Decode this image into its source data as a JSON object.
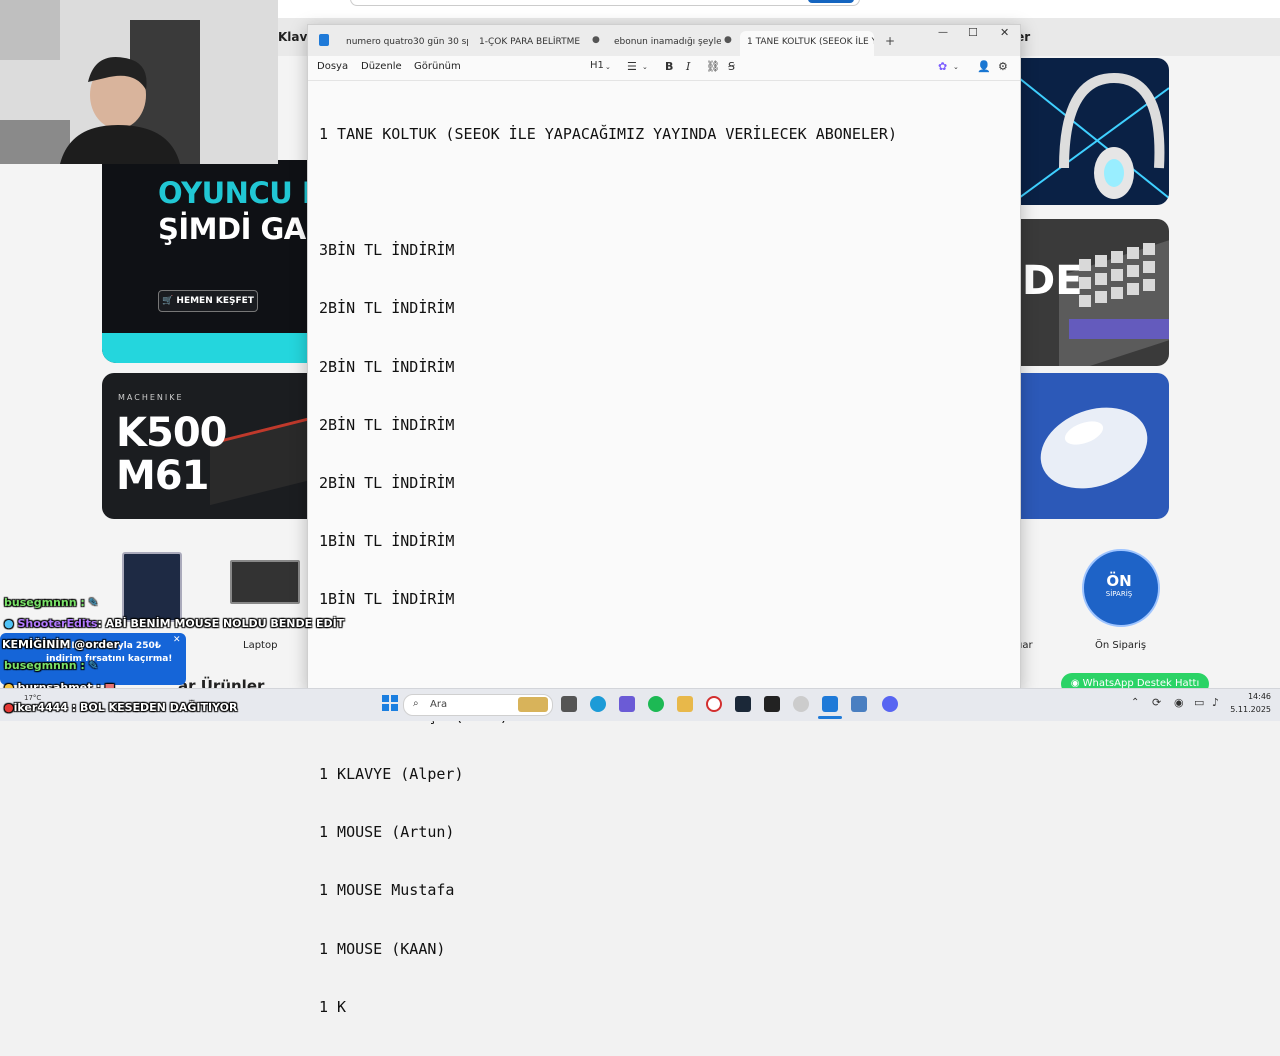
{
  "site": {
    "nav_left": "Klavy",
    "nav_right": "ler",
    "banner_line1": "OYUNCU KO",
    "banner_line2": "ŞİMDİ GA",
    "banner_button": "HEMEN KEŞFET",
    "k500_brand": "MACHENIKE",
    "k500_line1": "K500",
    "k500_line2": "M61",
    "rb2_text": "DE",
    "cat_laptop": "Laptop",
    "cat_uar": "uar",
    "on_badge_1": "ÖN",
    "on_badge_2": "SİPARİŞ",
    "cat_onsiparis": "Ön Sipariş",
    "section_title": "ar Ürünler",
    "whatsapp": "WhatsApp Destek Hattı"
  },
  "notepad": {
    "tabs": [
      {
        "label": "numero quatro30 gün 30 spor.txt"
      },
      {
        "label": "1-ÇOK PARA BELİRTME"
      },
      {
        "label": "ebonun inamadığı şeyler"
      },
      {
        "label": "1 TANE KOLTUK (SEEOK İLE Y"
      }
    ],
    "new_tab": "+",
    "menu": {
      "file": "Dosya",
      "edit": "Düzenle",
      "view": "Görünüm"
    },
    "toolbar": {
      "heading": "H1",
      "bold": "B",
      "italic": "I"
    },
    "window": {
      "minimize": "—",
      "maximize": "☐",
      "close": "✕"
    },
    "lines": [
      "1 TANE KOLTUK (SEEOK İLE YAPACAĞIMIZ YAYINDA VERİLECEK ABONELER)",
      "",
      "3BİN TL İNDİRİM",
      "2BİN TL İNDİRİM",
      "2BİN TL İNDİRİM",
      "2BİN TL İNDİRİM",
      "2BİN TL İNDİRİM",
      "1BİN TL İNDİRİM",
      "1BİN TL İNDİRİM",
      "",
      "18BİN TL BÜTÇE (GANK)",
      "1 KLAVYE (Alper)",
      "1 MOUSE (Artun)",
      "1 MOUSE Mustafa",
      "1 MOUSE (KAAN)",
      "1 K"
    ]
  },
  "chat": {
    "msg1_user": "busegmnnn :",
    "msg2_user": "ShooterEdits",
    "msg2_text": ": ABİ BENİM MOUSE NOLDU BENDE EDİT",
    "msg3_text": "KEMİĞİNİM @order",
    "msg4_user": "busegmnnn :",
    "msg5_user": "burnsahmet :",
    "msg6_user": "iker4444",
    "msg6_text": ": BOL KESEDEN DAĞITIYOR",
    "popup_line1": "CİZGİBİLAL koduyla 250₺",
    "popup_line2": "indirim fırsatını kaçırma!",
    "popup_close": "✕"
  },
  "taskbar": {
    "search_placeholder": "Ara",
    "weather": "17°C",
    "time": "14:46",
    "date": "5.11.2025"
  }
}
